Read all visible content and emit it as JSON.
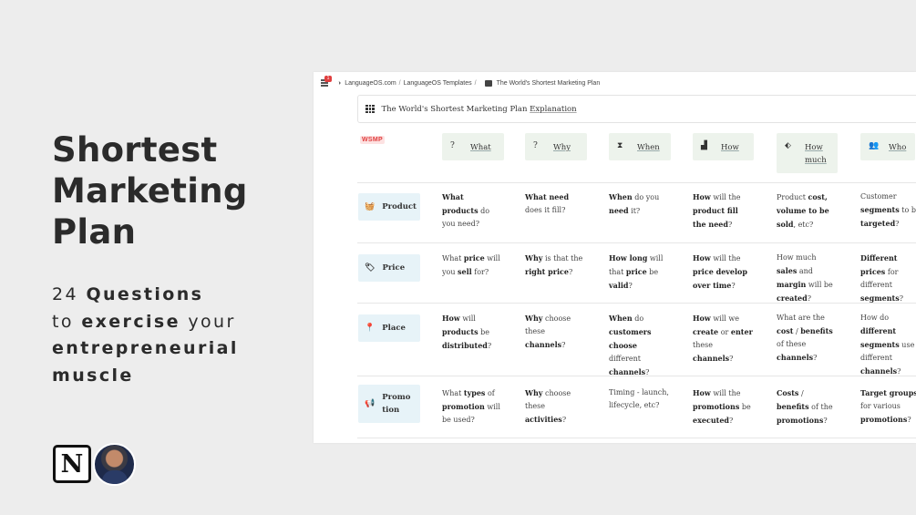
{
  "slide": {
    "title_lines": [
      "Shortest",
      "Marketing",
      "Plan"
    ],
    "subtitle": {
      "line1_num": "24",
      "line1_word": "Questions",
      "line2_pre": "to",
      "line2_bold": "exercise",
      "line2_post": "your",
      "line3": "entrepreneurial",
      "line4": "muscle"
    }
  },
  "breadcrumb": {
    "badge": "1",
    "items": [
      "LanguageOS.com",
      "LanguageOS Templates",
      "The World's Shortest Marketing Plan"
    ],
    "separator": "/"
  },
  "link_block": {
    "text_pre": "The World's Shortest Marketing Plan ",
    "text_ul": "Explanation"
  },
  "tag": "WSMP",
  "headers": [
    {
      "icon": "?",
      "label": "What"
    },
    {
      "icon": "?",
      "label": "Why"
    },
    {
      "icon": "⧗",
      "label": "When"
    },
    {
      "icon": "▟",
      "label": "How"
    },
    {
      "icon": "⬖",
      "label": "How much"
    },
    {
      "icon": "👥",
      "label": "Who"
    }
  ],
  "rows": [
    {
      "label": "Product",
      "icon": "🧺",
      "cells": [
        [
          [
            "b",
            "What products"
          ],
          [
            "n",
            " do you need?"
          ]
        ],
        [
          [
            "b",
            "What need"
          ],
          [
            "n",
            " does it fill?"
          ]
        ],
        [
          [
            "b",
            "When"
          ],
          [
            "n",
            " do you "
          ],
          [
            "b",
            "need"
          ],
          [
            "n",
            " it?"
          ]
        ],
        [
          [
            "b",
            "How"
          ],
          [
            "n",
            " will the "
          ],
          [
            "b",
            "product fill the need"
          ],
          [
            "n",
            "?"
          ]
        ],
        [
          [
            "n",
            "Product "
          ],
          [
            "b",
            "cost, volume to be sold"
          ],
          [
            "n",
            ", etc?"
          ]
        ],
        [
          [
            "n",
            "Customer "
          ],
          [
            "b",
            "segments"
          ],
          [
            "n",
            " to be "
          ],
          [
            "b",
            "targeted"
          ],
          [
            "n",
            "?"
          ]
        ]
      ]
    },
    {
      "label": "Price",
      "icon": "🏷",
      "cells": [
        [
          [
            "n",
            "What "
          ],
          [
            "b",
            "price"
          ],
          [
            "n",
            " will you "
          ],
          [
            "b",
            "sell"
          ],
          [
            "n",
            " for?"
          ]
        ],
        [
          [
            "b",
            "Why"
          ],
          [
            "n",
            " is that the "
          ],
          [
            "b",
            "right price"
          ],
          [
            "n",
            "?"
          ]
        ],
        [
          [
            "b",
            "How long"
          ],
          [
            "n",
            " will that "
          ],
          [
            "b",
            "price"
          ],
          [
            "n",
            " be "
          ],
          [
            "b",
            "valid"
          ],
          [
            "n",
            "?"
          ]
        ],
        [
          [
            "b",
            "How"
          ],
          [
            "n",
            " will the "
          ],
          [
            "b",
            "price develop over time"
          ],
          [
            "n",
            "?"
          ]
        ],
        [
          [
            "n",
            "How much "
          ],
          [
            "b",
            "sales"
          ],
          [
            "n",
            " and "
          ],
          [
            "b",
            "margin"
          ],
          [
            "n",
            " will be "
          ],
          [
            "b",
            "created"
          ],
          [
            "n",
            "?"
          ]
        ],
        [
          [
            "b",
            "Different prices"
          ],
          [
            "n",
            " for different "
          ],
          [
            "b",
            "segments"
          ],
          [
            "n",
            "?"
          ]
        ]
      ]
    },
    {
      "label": "Place",
      "icon": "📍",
      "cells": [
        [
          [
            "b",
            "How"
          ],
          [
            "n",
            " will "
          ],
          [
            "b",
            "products"
          ],
          [
            "n",
            " be "
          ],
          [
            "b",
            "distributed"
          ],
          [
            "n",
            "?"
          ]
        ],
        [
          [
            "b",
            "Why"
          ],
          [
            "n",
            " choose these "
          ],
          [
            "b",
            "channels"
          ],
          [
            "n",
            "?"
          ]
        ],
        [
          [
            "b",
            "When"
          ],
          [
            "n",
            " do "
          ],
          [
            "b",
            "customers choose"
          ],
          [
            "n",
            " different "
          ],
          [
            "b",
            "channels"
          ],
          [
            "n",
            "?"
          ]
        ],
        [
          [
            "b",
            "How"
          ],
          [
            "n",
            " will we "
          ],
          [
            "b",
            "create"
          ],
          [
            "n",
            " or "
          ],
          [
            "b",
            "enter"
          ],
          [
            "n",
            " these "
          ],
          [
            "b",
            "channels"
          ],
          [
            "n",
            "?"
          ]
        ],
        [
          [
            "n",
            "What are the "
          ],
          [
            "b",
            "cost"
          ],
          [
            "n",
            " / "
          ],
          [
            "b",
            "benefits"
          ],
          [
            "n",
            " of these "
          ],
          [
            "b",
            "channels"
          ],
          [
            "n",
            "?"
          ]
        ],
        [
          [
            "n",
            "How do "
          ],
          [
            "b",
            "different segments"
          ],
          [
            "n",
            " use different "
          ],
          [
            "b",
            "channels"
          ],
          [
            "n",
            "?"
          ]
        ]
      ]
    },
    {
      "label": "Promotion",
      "icon": "📢",
      "cells": [
        [
          [
            "n",
            "What "
          ],
          [
            "b",
            "types"
          ],
          [
            "n",
            " of "
          ],
          [
            "b",
            "promotion"
          ],
          [
            "n",
            " will be used?"
          ]
        ],
        [
          [
            "b",
            "Why"
          ],
          [
            "n",
            " choose these "
          ],
          [
            "b",
            "activities"
          ],
          [
            "n",
            "?"
          ]
        ],
        [
          [
            "n",
            "Timing - launch, lifecycle, etc?"
          ]
        ],
        [
          [
            "b",
            "How"
          ],
          [
            "n",
            " will the "
          ],
          [
            "b",
            "promotions"
          ],
          [
            "n",
            " be "
          ],
          [
            "b",
            "executed"
          ],
          [
            "n",
            "?"
          ]
        ],
        [
          [
            "b",
            "Costs"
          ],
          [
            "n",
            " / "
          ],
          [
            "b",
            "benefits"
          ],
          [
            "n",
            " of the "
          ],
          [
            "b",
            "promotions"
          ],
          [
            "n",
            "?"
          ]
        ],
        [
          [
            "b",
            "Target groups"
          ],
          [
            "n",
            " for various "
          ],
          [
            "b",
            "promotions"
          ],
          [
            "n",
            "?"
          ]
        ]
      ]
    }
  ]
}
